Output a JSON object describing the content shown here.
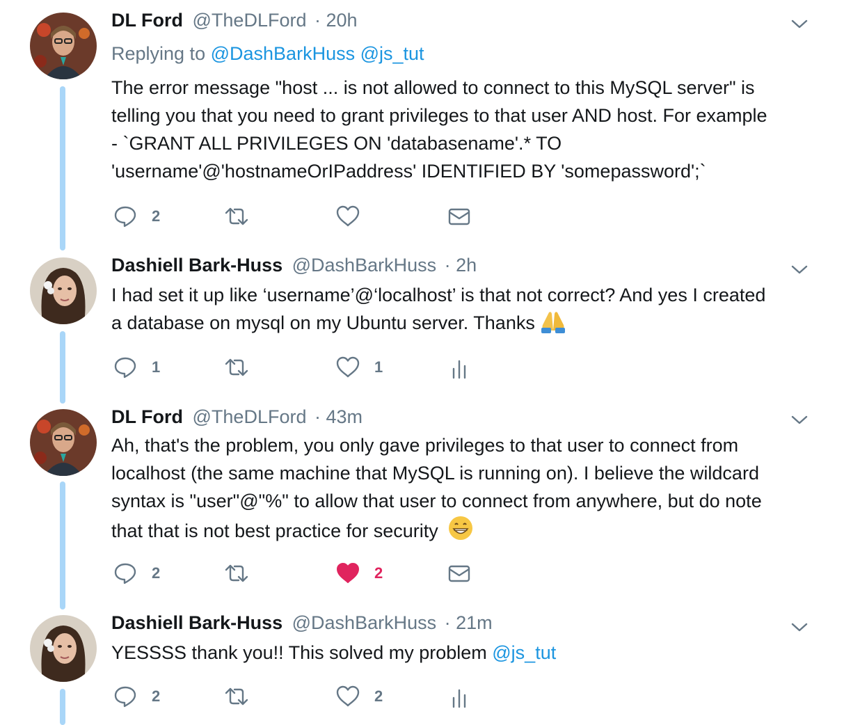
{
  "tweets": [
    {
      "name": "DL Ford",
      "handle": "@TheDLFord",
      "time": "· 20h",
      "replying_label": "Replying to",
      "replying_to": [
        "@DashBarkHuss",
        "@js_tut"
      ],
      "lines": [
        "The error message \"host ... is not allowed to connect to this MySQL server\" is",
        "telling you that you need to grant privileges to that user AND host.  For example",
        "- `GRANT ALL PRIVILEGES ON 'databasename'.* TO",
        "'username'@'hostnameOrIPaddress' IDENTIFIED BY 'somepassword';`"
      ],
      "reply_count": "2",
      "like_count": "",
      "actions": [
        "reply-icon",
        "retweet-icon",
        "like-icon",
        "message-icon"
      ]
    },
    {
      "name": "Dashiell Bark-Huss",
      "handle": "@DashBarkHuss",
      "time": "· 2h",
      "lines": [
        "I had set it up like ‘username’@‘localhost’ is that not correct? And yes I created",
        "a database on mysql on my Ubuntu server. Thanks"
      ],
      "emoji": "folded-hands-emoji",
      "reply_count": "1",
      "like_count": "1",
      "actions": [
        "reply-icon",
        "retweet-icon",
        "like-icon",
        "analytics-icon"
      ]
    },
    {
      "name": "DL Ford",
      "handle": "@TheDLFord",
      "time": "· 43m",
      "lines": [
        "Ah, that's the problem, you only gave privileges to that user to connect from",
        "localhost (the same machine that MySQL is running on). I believe the wildcard",
        "syntax is \"user\"@\"%\" to allow that user to connect from anywhere, but do note",
        "that that is not best practice for security"
      ],
      "emoji": "grinning-face-emoji",
      "reply_count": "2",
      "like_count": "2",
      "liked": true,
      "actions": [
        "reply-icon",
        "retweet-icon",
        "liked-heart-icon",
        "message-icon"
      ]
    },
    {
      "name": "Dashiell Bark-Huss",
      "handle": "@DashBarkHuss",
      "time": "· 21m",
      "text_before_link": "YESSSS thank you!! This solved my problem",
      "mention": "@js_tut",
      "reply_count": "2",
      "like_count": "2",
      "actions": [
        "reply-icon",
        "retweet-icon",
        "like-icon",
        "analytics-icon"
      ]
    }
  ],
  "colors": {
    "link": "#1b95e0",
    "secondary_text": "#657786",
    "thread_line": "#a9d6f8",
    "liked": "#e0245e"
  }
}
